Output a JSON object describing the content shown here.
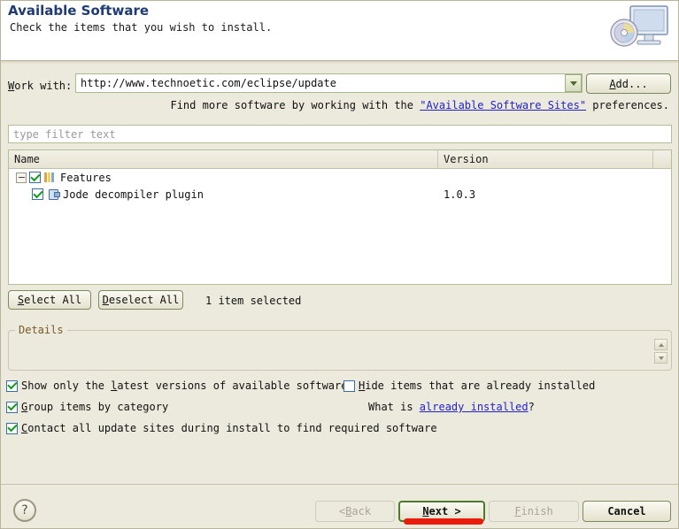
{
  "header": {
    "title": "Available Software",
    "subtitle": "Check the items that you wish to install.",
    "icon": "computer-with-cd-icon"
  },
  "work_with": {
    "label": "Work with:",
    "mnemonic": "W",
    "value": "http://www.technoetic.com/eclipse/update",
    "dropdown_icon": "chevron-down-icon",
    "add_button": "Add...",
    "add_mnemonic": "A"
  },
  "find_more": {
    "prefix": "Find more software by working with the ",
    "link": "\"Available Software Sites\"",
    "suffix": " preferences."
  },
  "filter": {
    "placeholder": "type filter text",
    "value": ""
  },
  "table": {
    "columns": [
      "Name",
      "Version"
    ],
    "rows": [
      {
        "name": "Features",
        "version": "",
        "checked": true,
        "expanded": true,
        "level": 0,
        "icon": "feature-bars-icon"
      },
      {
        "name": "Jode decompiler plugin",
        "version": "1.0.3",
        "checked": true,
        "level": 1,
        "icon": "plugin-icon"
      }
    ]
  },
  "selection": {
    "select_all": "Select All",
    "select_all_mnemonic": "S",
    "deselect_all": "Deselect All",
    "deselect_all_mnemonic": "D",
    "count_text": "1 item selected"
  },
  "details": {
    "legend": "Details",
    "content": "",
    "scroll_up_icon": "scroll-up-icon",
    "scroll_down_icon": "scroll-down-icon"
  },
  "options": {
    "latest": {
      "label": "Show only the latest versions of available software",
      "checked": true,
      "mnemonic": "l"
    },
    "group": {
      "label": "Group items by category",
      "checked": true,
      "mnemonic": "G"
    },
    "contact": {
      "label": "Contact all update sites during install to find required software",
      "checked": true,
      "mnemonic": "C"
    },
    "hide": {
      "label": "Hide items that are already installed",
      "checked": false,
      "mnemonic": "H"
    },
    "what_is": {
      "prefix": "What is ",
      "link": "already installed",
      "suffix": "?"
    }
  },
  "buttons": {
    "help": "?",
    "back": "< Back",
    "back_mnemonic": "B",
    "back_enabled": false,
    "next": "Next >",
    "next_mnemonic": "N",
    "next_enabled": true,
    "next_focused": true,
    "finish": "Finish",
    "finish_mnemonic": "F",
    "finish_enabled": false,
    "cancel": "Cancel",
    "cancel_enabled": true
  },
  "annotation": {
    "type": "red-underline-stroke",
    "color": "#e81b0c",
    "target": "next-button"
  },
  "colors": {
    "dialog_background": "#ece9dd",
    "title_color": "#1f3b73",
    "link_color": "#2222c8",
    "field_border": "#a9bb8c",
    "focus_border": "#4d7a2c",
    "legend_color": "#7a5a2a"
  }
}
